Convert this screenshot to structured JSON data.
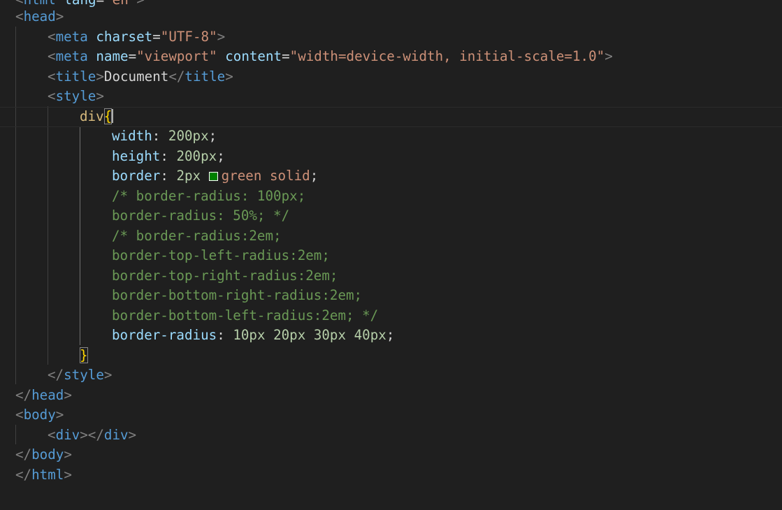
{
  "editor": {
    "theme_colors": {
      "background": "#1f1f1f",
      "tag": "#569cd6",
      "attribute": "#9cdcfe",
      "string": "#ce9178",
      "selector": "#d7ba7d",
      "brace": "#ffd700",
      "number": "#b5cea8",
      "comment": "#6a9955",
      "swatch_green": "#008000"
    },
    "lines": {
      "l0": {
        "open": "<",
        "tag": "html",
        "attr": "lang",
        "eq": "=",
        "val": "\"en\"",
        "close": ">"
      },
      "l1": {
        "open": "<",
        "tag": "head",
        "close": ">"
      },
      "l2": {
        "open": "<",
        "tag": "meta",
        "attr": "charset",
        "eq": "=",
        "val": "\"UTF-8\"",
        "close": ">"
      },
      "l3": {
        "open": "<",
        "tag": "meta",
        "attr1": "name",
        "eq1": "=",
        "val1": "\"viewport\"",
        "attr2": "content",
        "eq2": "=",
        "val2": "\"width=device-width, initial-scale=1.0\"",
        "close": ">"
      },
      "l4": {
        "open": "<",
        "tag": "title",
        "close": ">",
        "text": "Document",
        "open2": "</",
        "tag2": "title",
        "close2": ">"
      },
      "l5": {
        "open": "<",
        "tag": "style",
        "close": ">"
      },
      "l6": {
        "selector": "div",
        "brace": "{"
      },
      "l7": {
        "prop": "width",
        "colon": ":",
        "num": "200px",
        "semi": ";"
      },
      "l8": {
        "prop": "height",
        "colon": ":",
        "num": "200px",
        "semi": ";"
      },
      "l9": {
        "prop": "border",
        "colon": ":",
        "num": "2px",
        "val": "green solid",
        "semi": ";"
      },
      "l10": {
        "comment": "/* border-radius: 100px;"
      },
      "l11": {
        "comment": "border-radius: 50%; */"
      },
      "l12": {
        "comment": "/* border-radius:2em;"
      },
      "l13": {
        "comment": "border-top-left-radius:2em;"
      },
      "l14": {
        "comment": "border-top-right-radius:2em;"
      },
      "l15": {
        "comment": "border-bottom-right-radius:2em;"
      },
      "l16": {
        "comment": "border-bottom-left-radius:2em; */"
      },
      "l17": {
        "prop": "border-radius",
        "colon": ":",
        "num": "10px 20px 30px 40px",
        "semi": ";"
      },
      "l18": {
        "brace": "}"
      },
      "l19": {
        "open": "</",
        "tag": "style",
        "close": ">"
      },
      "l20": {
        "open": "</",
        "tag": "head",
        "close": ">"
      },
      "l21": {
        "open": "<",
        "tag": "body",
        "close": ">"
      },
      "l22": {
        "open": "<",
        "tag": "div",
        "close": ">",
        "open2": "</",
        "tag2": "div",
        "close2": ">"
      },
      "l23": {
        "open": "</",
        "tag": "body",
        "close": ">"
      },
      "l24": {
        "open": "</",
        "tag": "html",
        "close": ">"
      }
    }
  }
}
